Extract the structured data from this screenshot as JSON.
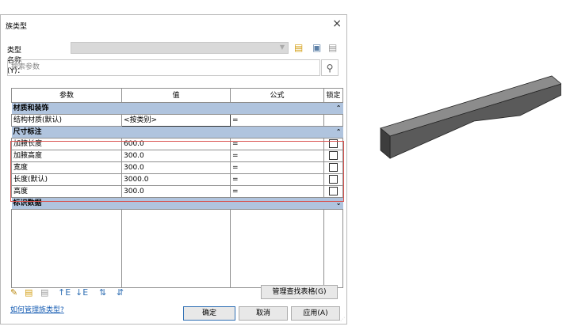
{
  "dialog": {
    "title": "族类型",
    "close_label": "×",
    "type_name_label": "类型名称(Y)：",
    "type_name_value": "",
    "search_placeholder": "搜索参数",
    "columns": [
      "参数",
      "值",
      "公式",
      "锁定"
    ],
    "groups": [
      {
        "name": "材质和装饰",
        "rows": [
          {
            "param": "结构材质(默认)",
            "value": "<按类别>",
            "formula": "=",
            "lock": false,
            "show_lock": false
          }
        ]
      },
      {
        "name": "尺寸标注",
        "rows": [
          {
            "param": "加腋长度",
            "value": "600.0",
            "formula": "=",
            "lock": false,
            "show_lock": true
          },
          {
            "param": "加腋高度",
            "value": "300.0",
            "formula": "=",
            "lock": false,
            "show_lock": true
          },
          {
            "param": "宽度",
            "value": "300.0",
            "formula": "=",
            "lock": false,
            "show_lock": true
          },
          {
            "param": "长度(默认)",
            "value": "3000.0",
            "formula": "=",
            "lock": false,
            "show_lock": true
          },
          {
            "param": "高度",
            "value": "300.0",
            "formula": "=",
            "lock": false,
            "show_lock": true
          }
        ]
      },
      {
        "name": "标识数据",
        "rows": []
      }
    ],
    "manage_lookup_label": "管理查找表格(G)",
    "help_link": "如何管理族类型?",
    "ok_label": "确定",
    "cancel_label": "取消",
    "apply_label": "应用(A)"
  },
  "icons": {
    "new_type": "new-type-icon",
    "rename_type": "rename-type-icon",
    "delete_type": "delete-type-icon",
    "edit": "pencil-icon",
    "sort_asc": "sort-ascending-icon",
    "sort_desc": "sort-descending-icon",
    "move_up": "move-up-icon",
    "move_down": "move-down-icon"
  },
  "colors": {
    "group_header": "#b0c4de",
    "highlight_box": "#d9534f",
    "link": "#1a5fb4",
    "beam_top": "#8c8c8c",
    "beam_side": "#5a5a5a"
  }
}
